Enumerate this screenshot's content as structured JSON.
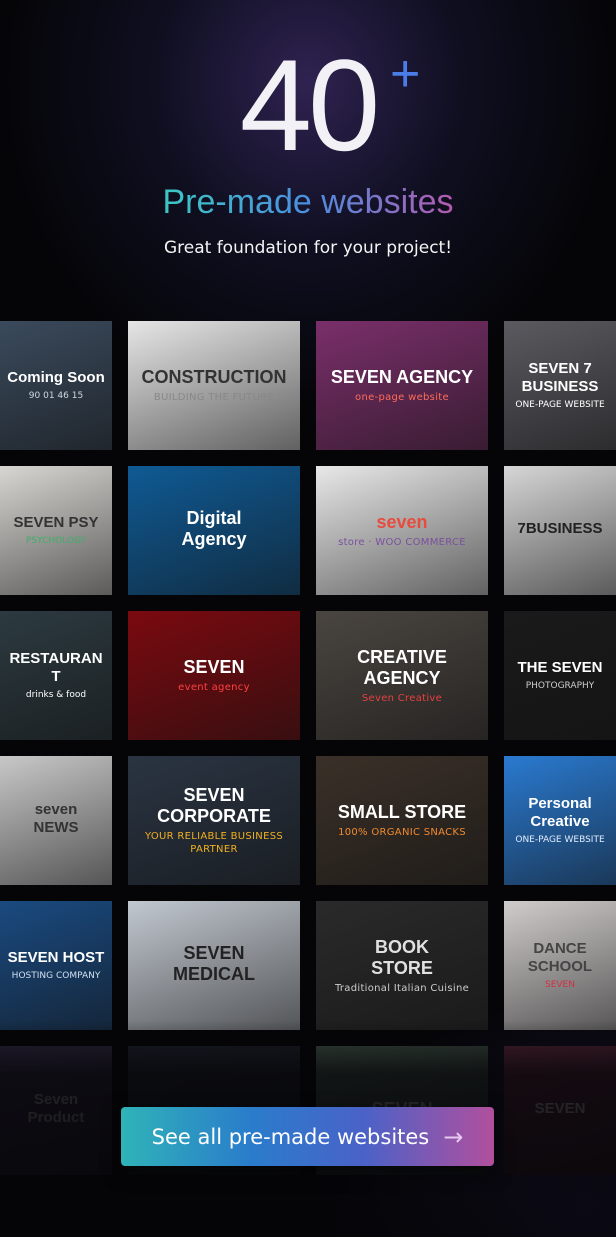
{
  "hero": {
    "count": "40",
    "plus": "+",
    "subtitle": "Pre-made websites",
    "tagline": "Great foundation for your project!"
  },
  "colors": {
    "accent_teal": "#3cc7c2",
    "accent_blue": "#4b8fe0",
    "accent_purple": "#b45ab0"
  },
  "tiles": [
    {
      "title": "Coming Soon",
      "subtitle": "90  01  46  15",
      "bg": "#3a4a5c",
      "fg": "#ffffff",
      "sc": "#cfd8e0"
    },
    {
      "title": "CONSTRUCTION",
      "subtitle": "BUILDING THE FUTURE",
      "bg": "#e6e6e6",
      "fg": "#333333",
      "sc": "#888888"
    },
    {
      "title": "SEVEN AGENCY",
      "subtitle": "one-page website",
      "bg": "#7a2f6a",
      "fg": "#ffffff",
      "sc": "#ff6a5a"
    },
    {
      "title": "SEVEN 7\nBUSINESS",
      "subtitle": "ONE-PAGE WEBSITE",
      "bg": "#5a5a60",
      "fg": "#ffffff",
      "sc": "#ffffff"
    },
    {
      "title": "SEVEN PSY",
      "subtitle": "PSYCHOLOGY",
      "bg": "#d8d6d2",
      "fg": "#333333",
      "sc": "#3fae6a"
    },
    {
      "title": "Digital\nAgency",
      "subtitle": "",
      "bg": "#0f5a94",
      "fg": "#ffffff",
      "sc": "#ffffff"
    },
    {
      "title": "seven",
      "subtitle": "store  ·  WOO COMMERCE",
      "bg": "#e8e8e8",
      "fg": "#e74c3c",
      "sc": "#7b4f9d"
    },
    {
      "title": "7BUSINESS",
      "subtitle": "",
      "bg": "#d6d6d6",
      "fg": "#222222",
      "sc": "#444444"
    },
    {
      "title": "RESTAURANT",
      "subtitle": "drinks & food",
      "bg": "#2c3a40",
      "fg": "#ffffff",
      "sc": "#ffffff"
    },
    {
      "title": "SEVEN",
      "subtitle": "event agency",
      "bg": "#7a0a10",
      "fg": "#ffffff",
      "sc": "#ff4040"
    },
    {
      "title": "CREATIVE\nAGENCY",
      "subtitle": "Seven Creative",
      "bg": "#4a4540",
      "fg": "#ffffff",
      "sc": "#e84040"
    },
    {
      "title": "THE SEVEN",
      "subtitle": "PHOTOGRAPHY",
      "bg": "#1a1a1a",
      "fg": "#ffffff",
      "sc": "#cccccc"
    },
    {
      "title": "seven\nNEWS",
      "subtitle": "",
      "bg": "#c8c8c8",
      "fg": "#333333",
      "sc": "#333333"
    },
    {
      "title": "SEVEN CORPORATE",
      "subtitle": "YOUR RELIABLE BUSINESS PARTNER",
      "bg": "#2a3442",
      "fg": "#ffffff",
      "sc": "#f0b020"
    },
    {
      "title": "SMALL STORE",
      "subtitle": "100% ORGANIC SNACKS",
      "bg": "#3a3028",
      "fg": "#ffffff",
      "sc": "#f08a30"
    },
    {
      "title": "Personal Creative",
      "subtitle": "ONE-PAGE WEBSITE",
      "bg": "#2a7ad0",
      "fg": "#ffffff",
      "sc": "#e0ecff"
    },
    {
      "title": "SEVEN HOST",
      "subtitle": "HOSTING COMPANY",
      "bg": "#1a4a80",
      "fg": "#ffffff",
      "sc": "#cfe0f0"
    },
    {
      "title": "SEVEN\nMEDICAL",
      "subtitle": "",
      "bg": "#c2c8d0",
      "fg": "#222222",
      "sc": "#222222"
    },
    {
      "title": "BOOK\nSTORE",
      "subtitle": "Traditional Italian Cuisine",
      "bg": "#2a2a2a",
      "fg": "#e0e0e0",
      "sc": "#cccccc"
    },
    {
      "title": "DANCE\nSCHOOL",
      "subtitle": "SEVEN",
      "bg": "#d0cccc",
      "fg": "#444444",
      "sc": "#d03040"
    },
    {
      "title": "Seven\nProduct",
      "subtitle": "",
      "bg": "#2a2238",
      "fg": "#777777",
      "sc": "#777777"
    },
    {
      "title": "",
      "subtitle": "",
      "bg": "#1a1e28",
      "fg": "#777777",
      "sc": "#777777"
    },
    {
      "title": "SEVEN",
      "subtitle": "",
      "bg": "#3a4a40",
      "fg": "#888888",
      "sc": "#777777"
    },
    {
      "title": "SEVEN",
      "subtitle": "",
      "bg": "#4a2030",
      "fg": "#888888",
      "sc": "#777777"
    }
  ],
  "cta": {
    "label": "See all pre-made websites",
    "icon": "arrow-right-icon",
    "arrow": "→"
  }
}
